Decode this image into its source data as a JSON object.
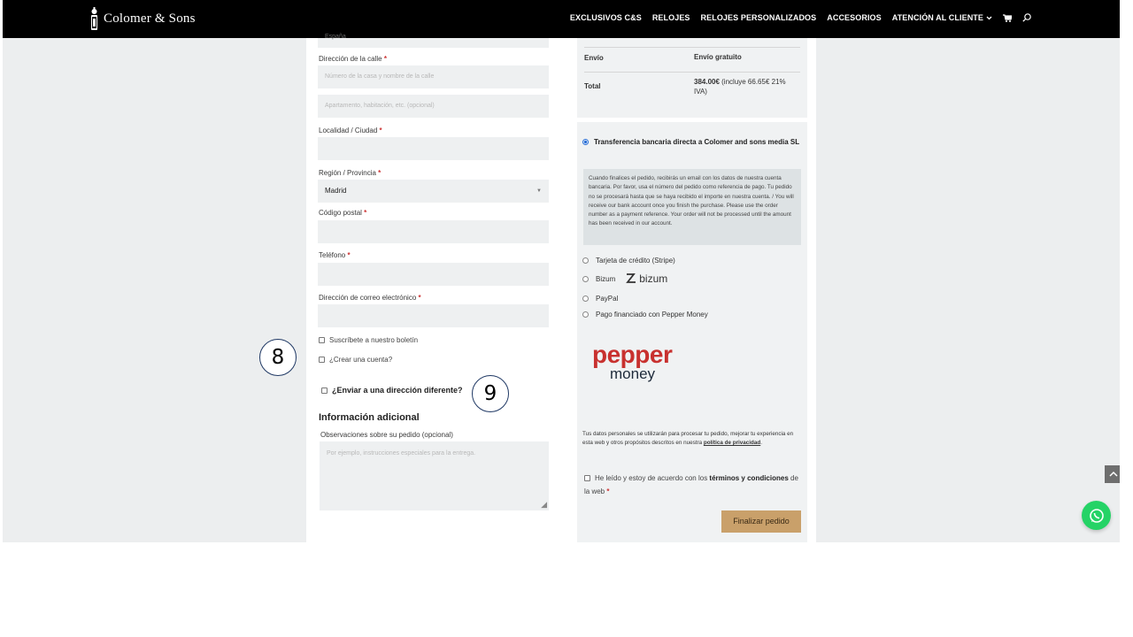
{
  "header": {
    "brand": "Colomer & Sons",
    "nav": [
      "EXCLUSIVOS C&S",
      "RELOJES",
      "RELOJES PERSONALIZADOS",
      "ACCESORIOS",
      "ATENCIÓN AL CLIENTE"
    ],
    "cart_icon": "cart-icon",
    "search_icon": "search-icon"
  },
  "billing": {
    "country_value_cut": "España",
    "street_label": "Dirección de la calle",
    "street_placeholder": "Número de la casa y nombre de la calle",
    "street2_placeholder": "Apartamento, habitación, etc. (opcional)",
    "city_label": "Localidad / Ciudad",
    "region_label": "Región / Provincia",
    "region_value": "Madrid",
    "postcode_label": "Código postal",
    "phone_label": "Teléfono",
    "email_label": "Dirección de correo electrónico",
    "required_mark": "*",
    "newsletter_label": "Suscríbete a nuestro boletín",
    "create_account_label": "¿Crear una cuenta?",
    "ship_different_label": "¿Enviar a una dirección diferente?"
  },
  "additional": {
    "heading": "Información adicional",
    "notes_label": "Observaciones sobre su pedido (opcional)",
    "notes_placeholder": "Por ejemplo, instrucciones especiales para la entrega."
  },
  "summary": {
    "shipping_label": "Envío",
    "shipping_value": "Envío gratuito",
    "total_label": "Total",
    "total_amount": "384.00€",
    "total_tax": " (incluye 66.65€ 21% IVA)"
  },
  "payment": {
    "bank_transfer_label": "Transferencia bancaria directa a Colomer and sons media SL",
    "bank_transfer_desc": "Cuando finalices el pedido, recibirás un email con los datos de nuestra cuenta bancaria. Por favor, usa el número del pedido como referencia de pago. Tu pedido no se procesará hasta que se haya recibido el importe en nuestra cuenta. / You will receive our bank account once you finish the purchase. Please use the order number as a payment reference. Your order will not be processed until the amount has been received in our account.",
    "card_label": "Tarjeta de crédito (Stripe)",
    "bizum_label": "Bizum",
    "bizum_logo_text": "bizum",
    "paypal_label": "PayPal",
    "pepper_label": "Pago financiado con Pepper Money",
    "pepper_logo_top": "pepper",
    "pepper_logo_bottom": "money",
    "privacy_text": "Tus datos personales se utilizarán para procesar tu pedido, mejorar tu experiencia en esta web y otros propósitos descritos en nuestra ",
    "privacy_link": "política de privacidad",
    "privacy_end": ".",
    "terms_pre": "He leído y estoy de acuerdo con los ",
    "terms_link": "términos y condiciones",
    "terms_post": " de la web ",
    "submit_label": "Finalizar pedido"
  },
  "annotations": {
    "marker_8": "8",
    "marker_9": "9"
  },
  "colors": {
    "topbar": "#000000",
    "page_bg": "#eceeef",
    "button": "#c9a06a",
    "whatsapp": "#25d366",
    "pepper_red": "#c8312f"
  }
}
